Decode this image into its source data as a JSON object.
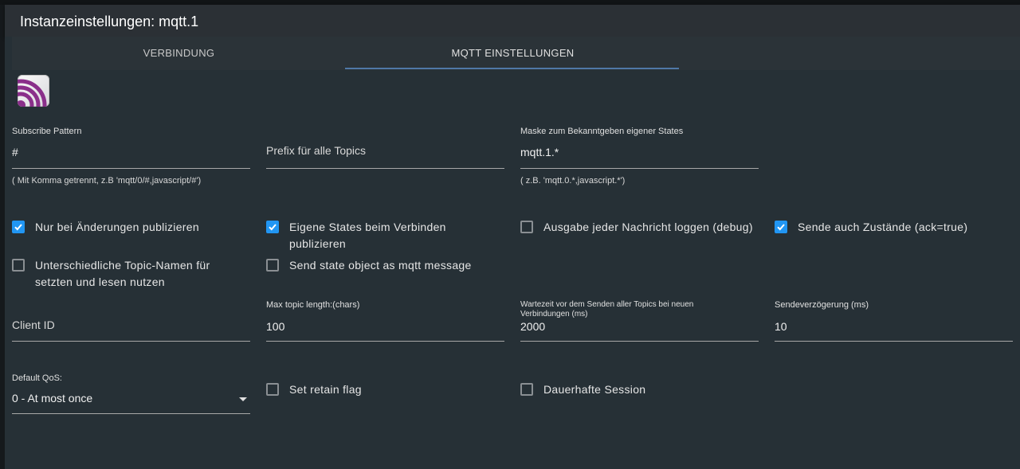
{
  "header": {
    "title": "Instanzeinstellungen: mqtt.1"
  },
  "tabs": [
    {
      "label": "VERBINDUNG",
      "active": false
    },
    {
      "label": "MQTT EINSTELLUNGEN",
      "active": true
    }
  ],
  "logo": {
    "icon": "mqtt-logo-icon"
  },
  "fields": {
    "subscribe_pattern": {
      "label": "Subscribe Pattern",
      "value": "#",
      "hint": "( Mit Komma getrennt, z.B 'mqtt/0/#,javascript/#')"
    },
    "prefix": {
      "placeholder": "Prefix für alle Topics"
    },
    "mask": {
      "label": "Maske zum Bekanntgeben eigener States",
      "value": "mqtt.1.*",
      "hint": "( z.B. 'mqtt.0.*,javascript.*')"
    },
    "client_id": {
      "placeholder": "Client ID"
    },
    "max_topic_length": {
      "label": "Max topic length:(chars)",
      "value": "100"
    },
    "wait_time": {
      "label": "Wartezeit vor dem Senden aller Topics bei neuen Verbindungen (ms)",
      "value": "2000"
    },
    "send_delay": {
      "label": "Sendeverzögerung (ms)",
      "value": "10"
    },
    "default_qos": {
      "label": "Default QoS:",
      "value": "0 - At most once"
    }
  },
  "checkboxes": {
    "publish_on_change": {
      "label": "Nur bei Änderungen publizieren",
      "checked": true
    },
    "publish_own_states": {
      "label": "Eigene States beim Verbinden publizieren",
      "checked": true
    },
    "debug_log": {
      "label": "Ausgabe jeder Nachricht loggen (debug)",
      "checked": false
    },
    "send_ack": {
      "label": "Sende auch Zustände (ack=true)",
      "checked": true
    },
    "different_topics": {
      "label": "Unterschiedliche Topic-Namen für setzten und lesen nutzen",
      "checked": false
    },
    "state_object": {
      "label": "Send state object as mqtt message",
      "checked": false
    },
    "retain": {
      "label": "Set retain flag",
      "checked": false
    },
    "persistent_session": {
      "label": "Dauerhafte Session",
      "checked": false
    }
  },
  "colors": {
    "accent": "#2196f3",
    "tab_indicator": "#4f78a7",
    "background": "#263036"
  }
}
